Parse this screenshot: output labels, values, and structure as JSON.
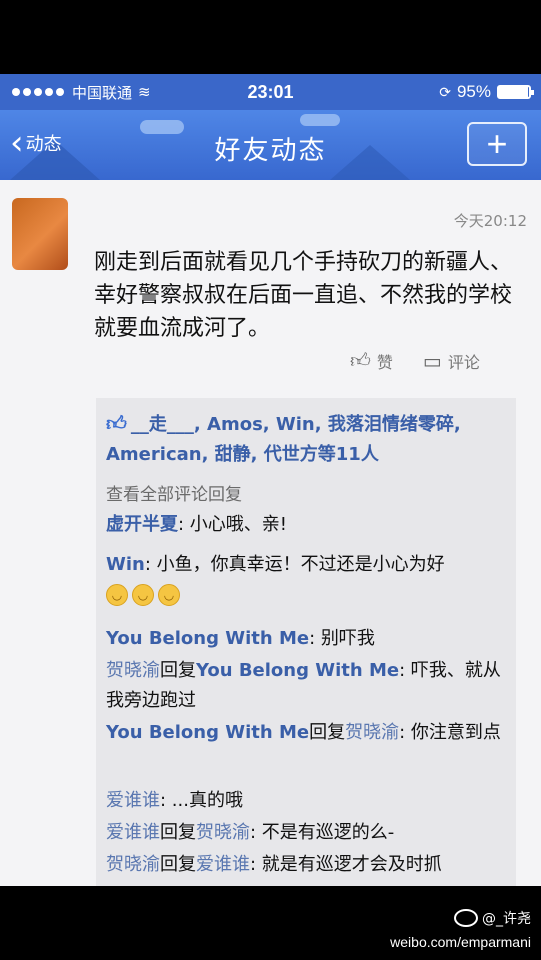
{
  "status_bar": {
    "carrier": "中国联通",
    "time": "23:01",
    "battery": "95%",
    "battery_level": 0.95
  },
  "nav": {
    "back_label": "动态",
    "title": "好友动态",
    "plus_label": "+"
  },
  "post": {
    "timestamp": "今天20:12",
    "text": "刚走到后面就看见几个手持砍刀的新疆人、幸好警察叔叔在后面一直追、不然我的学校就要血流成河了。",
    "like_label": "赞",
    "comment_label": "评论"
  },
  "likes_line": "__走___, Amos, Win, 我落泪情绪零碎, American, 甜静, 代世方等11人",
  "view_all": "查看全部评论回复",
  "comments": [
    {
      "name": "虚开半夏",
      "reply_to": "",
      "text": "小心哦、亲!"
    },
    {
      "name": "Win",
      "reply_to": "",
      "text": "小鱼，你真幸运！不过还是小心为好"
    },
    {
      "name": "You Belong With Me",
      "reply_to": "",
      "text": "别吓我"
    },
    {
      "name": "贺晓渝",
      "reply_to": "You Belong With Me",
      "text": "吓我、就从我旁边跑过"
    },
    {
      "name": "You Belong With Me",
      "reply_to": "贺晓渝",
      "text": "你注意到点"
    },
    {
      "name": "爱谁谁",
      "reply_to": "",
      "text": "...真的哦"
    },
    {
      "name": "爱谁谁",
      "reply_to": "贺晓渝",
      "text": "不是有巡逻的么-"
    },
    {
      "name": "贺晓渝",
      "reply_to": "爱谁谁",
      "text": "就是有巡逻才会及时抓"
    }
  ],
  "reply_word": "回复",
  "watermark": {
    "user": "@_许尧",
    "url": "weibo.com/emparmani"
  }
}
